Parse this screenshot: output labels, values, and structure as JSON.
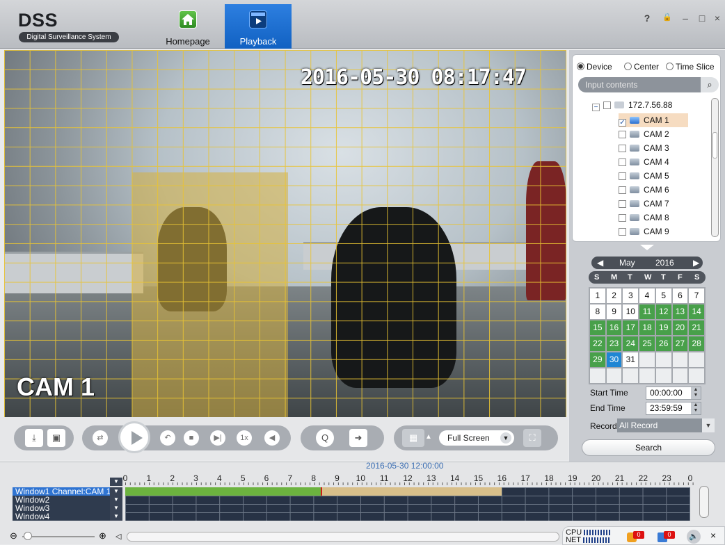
{
  "app": {
    "title": "DSS",
    "subtitle": "Digital Surveillance System"
  },
  "nav": {
    "homepage": "Homepage",
    "playback": "Playback"
  },
  "window_controls": {
    "help": "?",
    "lock": "🔒",
    "minimize": "–",
    "maximize": "□",
    "close": "×"
  },
  "video": {
    "timestamp": "2016-05-30 08:17:47",
    "camera_label": "CAM 1"
  },
  "controls": {
    "speed": "1x",
    "fullscreen_label": "Full Screen"
  },
  "device_panel": {
    "radios": [
      "Device",
      "Center",
      "Time Slice"
    ],
    "selected_radio": "Device",
    "search_placeholder": "Input contents",
    "root_device": "172.7.56.88",
    "cameras": [
      "CAM 1",
      "CAM 2",
      "CAM 3",
      "CAM 4",
      "CAM 5",
      "CAM 6",
      "CAM 7",
      "CAM 8",
      "CAM 9"
    ],
    "checked_camera": "CAM 1"
  },
  "calendar": {
    "month": "May",
    "year": "2016",
    "weekdays": [
      "S",
      "M",
      "T",
      "W",
      "T",
      "F",
      "S"
    ],
    "days": [
      "1",
      "2",
      "3",
      "4",
      "5",
      "6",
      "7",
      "8",
      "9",
      "10",
      "11",
      "12",
      "13",
      "14",
      "15",
      "16",
      "17",
      "18",
      "19",
      "20",
      "21",
      "22",
      "23",
      "24",
      "25",
      "26",
      "27",
      "28",
      "29",
      "30",
      "31"
    ],
    "record_days": [
      11,
      12,
      13,
      14,
      15,
      16,
      17,
      18,
      19,
      20,
      21,
      22,
      23,
      24,
      25,
      26,
      27,
      28,
      29
    ],
    "selected_day": 30,
    "start_time_label": "Start Time",
    "start_time": "00:00:00",
    "end_time_label": "End Time",
    "end_time": "23:59:59",
    "record_type_label": "Record Type",
    "record_type": "All Record",
    "search_label": "Search"
  },
  "timeline": {
    "center_time": "2016-05-30 12:00:00",
    "hours": [
      "0",
      "1",
      "2",
      "3",
      "4",
      "5",
      "6",
      "7",
      "8",
      "9",
      "10",
      "11",
      "12",
      "13",
      "14",
      "15",
      "16",
      "17",
      "18",
      "19",
      "20",
      "21",
      "22",
      "23",
      "0"
    ],
    "windows": [
      "Window1 Channel:CAM 1",
      "Window2",
      "Window3",
      "Window4"
    ],
    "recorded_hours": [
      0,
      16
    ],
    "played_until_hour": 8.3
  },
  "status": {
    "cpu_label": "CPU",
    "net_label": "NET",
    "alarm_count": "0",
    "message_count": "0"
  }
}
